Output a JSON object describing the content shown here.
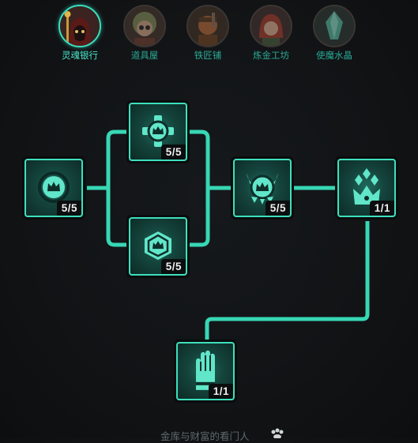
{
  "tabs": [
    {
      "label": "灵魂银行",
      "active": true,
      "icon": "soul-bank-portrait"
    },
    {
      "label": "道具屋",
      "active": false,
      "icon": "item-shop-portrait"
    },
    {
      "label": "铁匠铺",
      "active": false,
      "icon": "blacksmith-portrait"
    },
    {
      "label": "炼金工坊",
      "active": false,
      "icon": "alchemy-portrait"
    },
    {
      "label": "使魔水晶",
      "active": false,
      "icon": "familiar-crystal-portrait"
    }
  ],
  "nodes": [
    {
      "id": "crown-orb",
      "count": "5/5"
    },
    {
      "id": "cross-crown",
      "count": "5/5"
    },
    {
      "id": "cube-crown",
      "count": "5/5"
    },
    {
      "id": "horned-crown",
      "count": "5/5"
    },
    {
      "id": "crystal-crown",
      "count": "1/1"
    },
    {
      "id": "raised-hand",
      "count": "1/1"
    }
  ],
  "footer": {
    "title": "金库与财富的看门人"
  },
  "colors": {
    "accent": "#3de0bd",
    "line": "#37d7b4",
    "tab_label": "#2aa996"
  }
}
